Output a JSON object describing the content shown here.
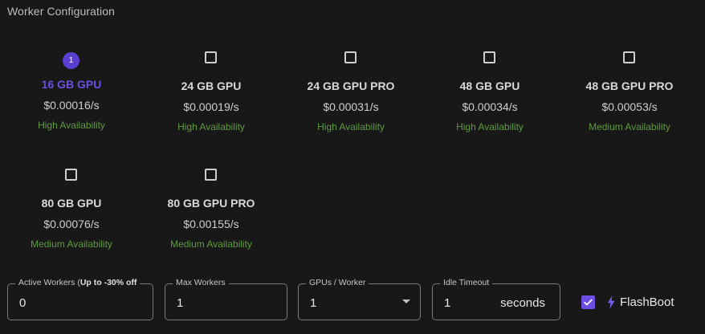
{
  "section_title": "Worker Configuration",
  "gpu_options": [
    {
      "name": "16 GB GPU",
      "price": "$0.00016/s",
      "availability": "High Availability",
      "selected": true,
      "order": "1"
    },
    {
      "name": "24 GB GPU",
      "price": "$0.00019/s",
      "availability": "High Availability",
      "selected": false
    },
    {
      "name": "24 GB GPU PRO",
      "price": "$0.00031/s",
      "availability": "High Availability",
      "selected": false
    },
    {
      "name": "48 GB GPU",
      "price": "$0.00034/s",
      "availability": "High Availability",
      "selected": false
    },
    {
      "name": "48 GB GPU PRO",
      "price": "$0.00053/s",
      "availability": "Medium Availability",
      "selected": false
    },
    {
      "name": "80 GB GPU",
      "price": "$0.00076/s",
      "availability": "Medium Availability",
      "selected": false
    },
    {
      "name": "80 GB GPU PRO",
      "price": "$0.00155/s",
      "availability": "Medium Availability",
      "selected": false
    }
  ],
  "fields": {
    "active_workers": {
      "label": "Active Workers (",
      "label_bold": "Up to -30% off",
      "value": "0"
    },
    "max_workers": {
      "label": "Max Workers",
      "value": "1"
    },
    "gpus_per_worker": {
      "label": "GPUs / Worker",
      "value": "1"
    },
    "idle_timeout": {
      "label": "Idle Timeout",
      "value": "1",
      "suffix": "seconds"
    }
  },
  "flashboot": {
    "label": "FlashBoot",
    "checked": true,
    "icon": "lightning-icon"
  },
  "colors": {
    "accent": "#6d4ee3",
    "availability": "#5e9b3f",
    "background": "#181818"
  }
}
